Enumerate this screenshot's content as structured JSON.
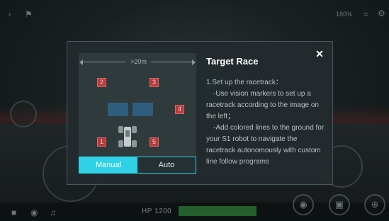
{
  "modal": {
    "title": "Target Race",
    "close_label": "✕",
    "illustration": {
      "distance_label": ">20m",
      "markers": [
        "2",
        "3",
        "4",
        "1",
        "5"
      ]
    },
    "tabs": [
      {
        "label": "Manual",
        "active": true
      },
      {
        "label": "Auto",
        "active": false
      }
    ],
    "body": {
      "step1": "1.Set up the racetrack：",
      "line1": "-Use vision markers to set up a racetrack according to the image on the left；",
      "line2": "-Add colored lines to the ground for your S1 robot to navigate the racetrack autonomously with custom line follow programs"
    }
  },
  "hud": {
    "battery": "180%",
    "hp_label": "HP 1200",
    "hp_fraction": 1.0,
    "accent_color": "#2fd1e6",
    "marker_color": "#b73a3a"
  }
}
